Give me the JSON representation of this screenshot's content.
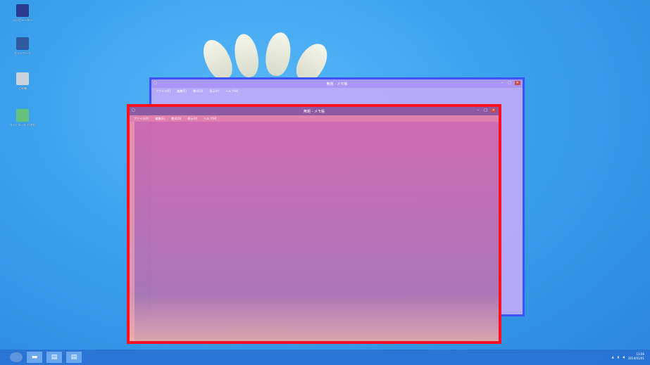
{
  "desktop": {
    "icons": [
      {
        "label": "コンピューター",
        "color": "#2a3b8c"
      },
      {
        "label": "ネットワーク",
        "color": "#2f5aa0"
      },
      {
        "label": "ごみ箱",
        "color": "#c9d3de"
      },
      {
        "label": "コントロール パネル",
        "color": "#66c27a"
      }
    ]
  },
  "back_window": {
    "title": "無題 - メモ帳",
    "menu": [
      "ファイル(F)",
      "編集(E)",
      "書式(O)",
      "表示(V)",
      "ヘルプ(H)"
    ],
    "highlight_color": "#3b52ff"
  },
  "front_window": {
    "title": "無題 - メモ帳",
    "menu": [
      "ファイル(F)",
      "編集(E)",
      "書式(O)",
      "表示(V)",
      "ヘルプ(H)"
    ],
    "highlight_color": "#ff1020"
  },
  "taskbar": {
    "buttons": [
      "start",
      "explorer",
      "notepad",
      "notepad"
    ],
    "clock_time": "13:06",
    "clock_date": "2014/01/01"
  }
}
